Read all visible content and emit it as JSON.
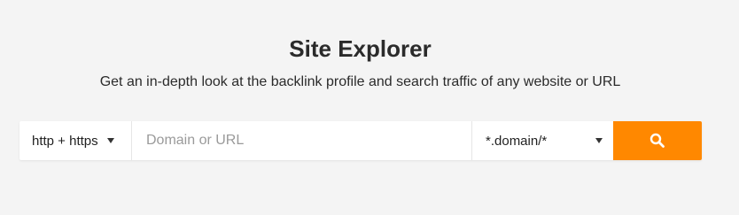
{
  "header": {
    "title": "Site Explorer",
    "subtitle": "Get an in-depth look at the backlink profile and search traffic of any website or URL"
  },
  "search": {
    "protocol": "http + https",
    "placeholder": "Domain or URL",
    "value": "",
    "mode": "*.domain/*",
    "button_icon": "search-icon",
    "button_color": "#ff8800"
  }
}
